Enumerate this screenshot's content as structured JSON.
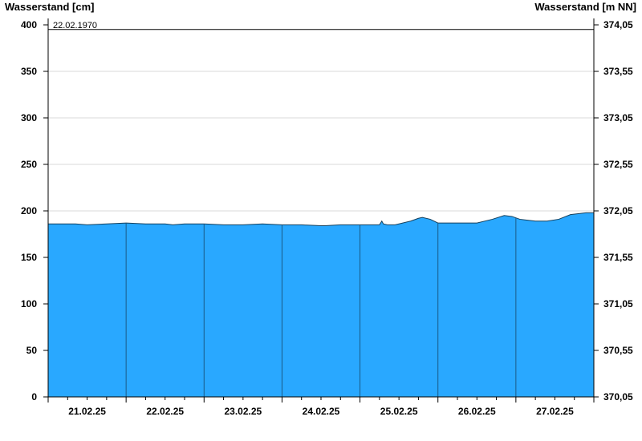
{
  "chart_data": {
    "type": "area",
    "left_axis_title": "Wasserstand [cm]",
    "right_axis_title": "Wasserstand [m NN]",
    "left_ylim": [
      0,
      400
    ],
    "left_ticks": [
      "0",
      "50",
      "100",
      "150",
      "200",
      "250",
      "300",
      "350",
      "400"
    ],
    "right_ticks": [
      "370,05",
      "370,55",
      "371,05",
      "371,55",
      "372,05",
      "372,55",
      "373,05",
      "373,55",
      "374,05"
    ],
    "x_tick_labels": [
      "21.02.25",
      "22.02.25",
      "23.02.25",
      "24.02.25",
      "25.02.25",
      "26.02.25",
      "27.02.25"
    ],
    "x_range_days": [
      0,
      7
    ],
    "grid": true,
    "reference_line": {
      "label": "22.02.1970",
      "value": 395
    },
    "colors": {
      "area": "#29a8ff",
      "edge": "#16405c",
      "day_line": "#1a5a86",
      "grid": "#d8d8d8"
    },
    "series": [
      {
        "x": [
          0,
          0.35,
          0.5,
          0.75,
          1.0,
          1.25,
          1.5,
          1.6,
          1.75,
          2.0,
          2.25,
          2.5,
          2.75,
          3.0,
          3.25,
          3.5,
          3.55,
          3.75,
          4.0,
          4.2,
          4.25,
          4.28,
          4.3,
          4.35,
          4.45,
          4.5,
          4.65,
          4.75,
          4.8,
          4.9,
          5.0,
          5.15,
          5.25,
          5.5,
          5.7,
          5.85,
          5.95,
          6.05,
          6.15,
          6.25,
          6.4,
          6.55,
          6.7,
          6.9,
          7.0
        ],
        "values": [
          186,
          186,
          185,
          186,
          187,
          186,
          186,
          185,
          186,
          186,
          185,
          185,
          186,
          185,
          185,
          184,
          184,
          185,
          185,
          185,
          185,
          189,
          186,
          185,
          185,
          186,
          189,
          192,
          193,
          191,
          187,
          187,
          187,
          187,
          191,
          195,
          194,
          191,
          190,
          189,
          189,
          191,
          196,
          198,
          198
        ]
      }
    ]
  }
}
